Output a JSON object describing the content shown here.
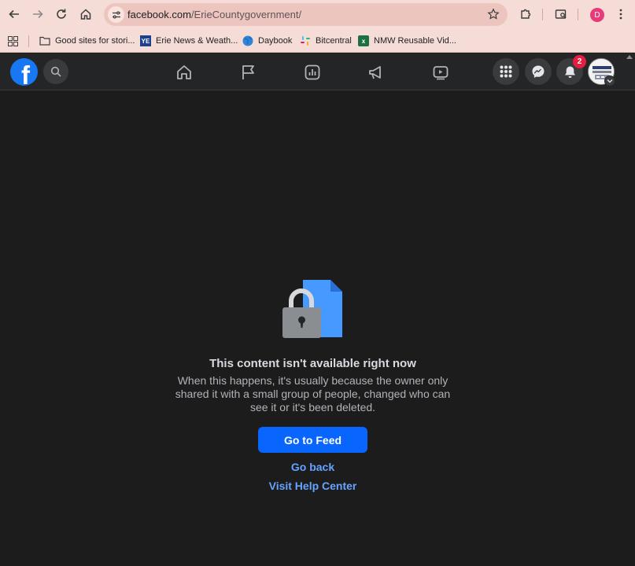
{
  "browser": {
    "url_host": "facebook.com",
    "url_path": "/ErieCountygovernment/",
    "profile_initial": "D",
    "bookmarks": [
      {
        "label": "Good sites for stori...",
        "icon": "folder-icon"
      },
      {
        "label": "Erie News & Weath...",
        "icon": "ye-icon"
      },
      {
        "label": "Daybook",
        "icon": "globe-icon"
      },
      {
        "label": "Bitcentral",
        "icon": "slack-icon"
      },
      {
        "label": "NMW Reusable Vid...",
        "icon": "excel-icon"
      }
    ]
  },
  "facebook": {
    "notification_count": "2",
    "nav_icons": [
      "home-icon",
      "pages-flag-icon",
      "dashboard-icon",
      "ads-megaphone-icon",
      "video-icon"
    ],
    "right_icons": [
      "menu-grid-icon",
      "messenger-icon",
      "notifications-bell-icon"
    ]
  },
  "content": {
    "title": "This content isn't available right now",
    "description": "When this happens, it's usually because the owner only shared it with a small group of people, changed who can see it or it's been deleted.",
    "go_to_feed": "Go to Feed",
    "go_back": "Go back",
    "visit_help_center": "Visit Help Center"
  },
  "colors": {
    "browser_chrome": "#f6dcd6",
    "fb_nav": "#242526",
    "page_bg": "#1c1c1d",
    "primary_button": "#0866ff",
    "link": "#66a3ff",
    "badge": "#e41e3f"
  }
}
